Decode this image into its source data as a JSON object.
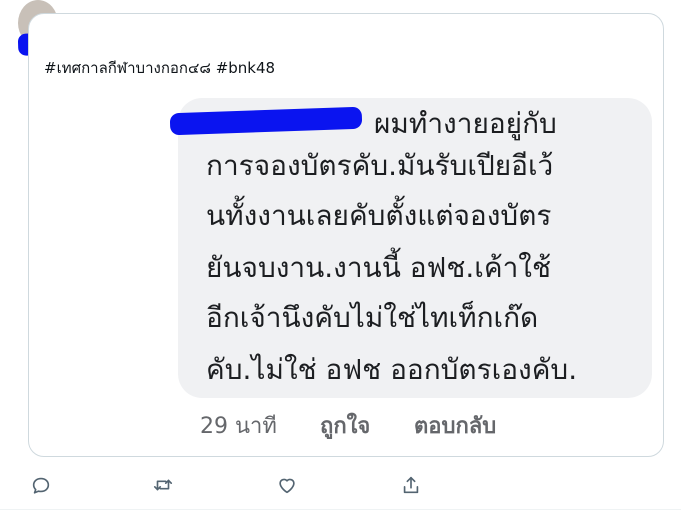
{
  "tweet": {
    "hashtags": "#เทศกาลกีฬาบางกอก๔๘ #bnk48"
  },
  "screenshot": {
    "comment_lines": [
      "ผมทำงายอยู่กับ",
      "การจองบัตรคับ.มันรับเปียอีเว้",
      "นทั้งงานเลยคับตั้งแต่จองบัตร",
      "ยันจบงาน.งานนี้ อฟช.เค้าใช้",
      "อีกเจ้านึงคับไม่ใช่ไทเท็กเก๊ด",
      "คับ.ไม่ใช่ อฟช ออกบัตรเองคับ."
    ],
    "time": "29 นาที",
    "like_label": "ถูกใจ",
    "reply_label": "ตอบกลับ"
  },
  "actions": {
    "icons": [
      "reply-icon",
      "retweet-icon",
      "like-icon",
      "share-icon"
    ]
  },
  "colors": {
    "redaction": "#0a14f0",
    "bubble": "#f0f1f3",
    "icon": "#536471"
  }
}
